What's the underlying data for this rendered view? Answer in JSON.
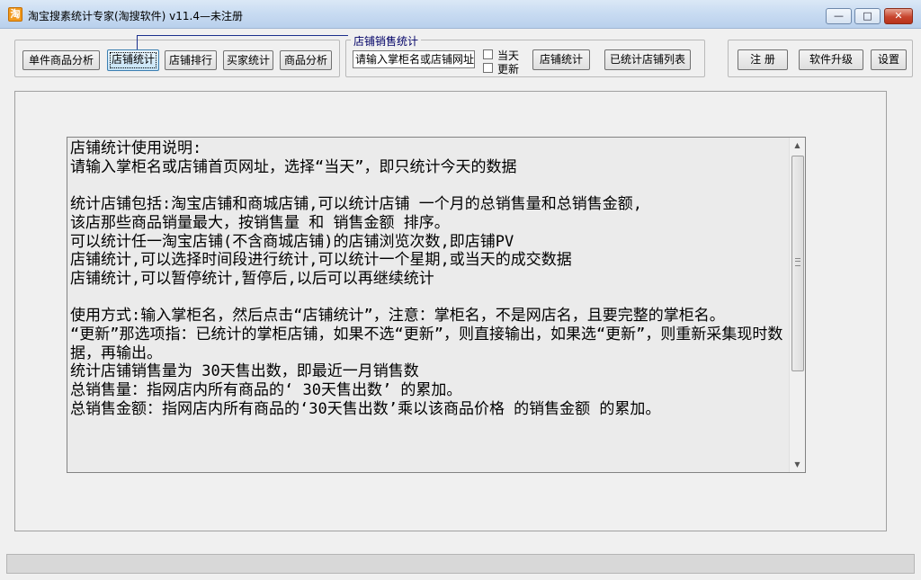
{
  "window": {
    "title": "淘宝搜素统计专家(淘搜软件) v11.4—未注册",
    "icon_glyph": "淘",
    "controls": {
      "minimize": "—",
      "maximize": "□",
      "close": "✕"
    }
  },
  "toolbar": {
    "left_buttons": [
      "单件商品分析",
      "店铺统计",
      "店铺排行",
      "买家统计",
      "商品分析"
    ],
    "active_button": "店铺统计"
  },
  "store_sales_group": {
    "caption": "店铺销售统计",
    "input_value": "请输入掌柜名或店铺网址",
    "checkbox_today": {
      "label": "当天",
      "checked": false
    },
    "checkbox_update": {
      "label": "更新",
      "checked": false
    },
    "stat_button": "店铺统计",
    "list_button": "已统计店铺列表"
  },
  "right_buttons": {
    "register": "注 册",
    "upgrade": "软件升级",
    "settings": "设置"
  },
  "memo": {
    "lines": [
      "店铺统计使用说明:",
      "请输入掌柜名或店铺首页网址，选择“当天”，即只统计今天的数据",
      "",
      "统计店铺包括:淘宝店铺和商城店铺,可以统计店铺 一个月的总销售量和总销售金额,",
      "该店那些商品销量最大，按销售量 和 销售金额 排序。",
      "可以统计任一淘宝店铺(不含商城店铺)的店铺浏览次数,即店铺PV",
      "店铺统计,可以选择时间段进行统计,可以统计一个星期,或当天的成交数据",
      "店铺统计,可以暂停统计,暂停后,以后可以再继续统计",
      "",
      "使用方式:输入掌柜名，然后点击“店铺统计”，注意：掌柜名，不是网店名，且要完整的掌柜名。",
      "“更新”那选项指：已统计的掌柜店铺，如果不选“更新”，则直接输出，如果选“更新”，则重新采集现时数据，再输出。",
      "统计店铺销售量为 30天售出数，即最近一月销售数",
      "总销售量：指网店内所有商品的‘ 30天售出数’ 的累加。",
      "总销售金额：指网店内所有商品的‘30天售出数’乘以该商品价格 的销售金额 的累加。"
    ]
  }
}
